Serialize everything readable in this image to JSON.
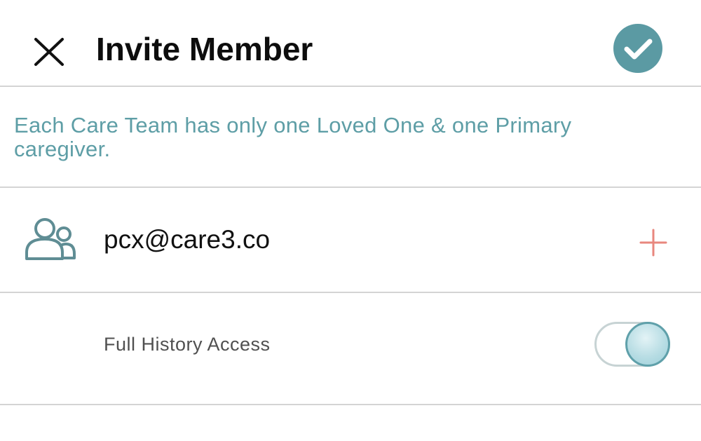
{
  "header": {
    "title": "Invite Member",
    "close_icon": "close-icon",
    "confirm_icon": "checkmark-icon"
  },
  "notice": {
    "text": "Each Care Team has only one Loved One & one Primary caregiver."
  },
  "invite": {
    "email": "pcx@care3.co",
    "people_icon": "people-icon",
    "add_icon": "plus-icon"
  },
  "access": {
    "label": "Full History Access",
    "enabled": true
  },
  "colors": {
    "accent_teal": "#5b9aa3",
    "notice_text": "#5e9ea6",
    "add_plus": "#e8877e",
    "divider": "#d4d4d4"
  }
}
